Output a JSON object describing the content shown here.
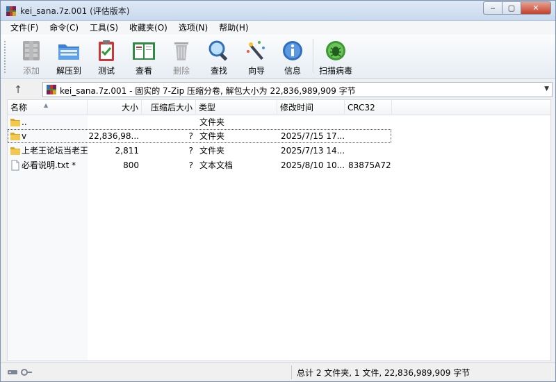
{
  "window": {
    "title": "kei_sana.7z.001 (评估版本)",
    "controls": {
      "minimize": "‒",
      "maximize": "▢",
      "close": "✕"
    }
  },
  "menu": [
    "文件(F)",
    "命令(C)",
    "工具(S)",
    "收藏夹(O)",
    "选项(N)",
    "帮助(H)"
  ],
  "toolbar": [
    {
      "label": "添加",
      "icon": "add-archive-icon",
      "disabled": true
    },
    {
      "label": "解压到",
      "icon": "extract-folder-icon",
      "disabled": false
    },
    {
      "label": "测试",
      "icon": "test-clipboard-icon",
      "disabled": false
    },
    {
      "label": "查看",
      "icon": "view-book-icon",
      "disabled": false
    },
    {
      "label": "删除",
      "icon": "trash-icon",
      "disabled": true
    },
    {
      "label": "查找",
      "icon": "magnifier-icon",
      "disabled": false
    },
    {
      "label": "向导",
      "icon": "wizard-wand-icon",
      "disabled": false
    },
    {
      "label": "信息",
      "icon": "info-icon",
      "disabled": false
    },
    {
      "label": "扫描病毒",
      "icon": "virus-bug-icon",
      "disabled": false
    }
  ],
  "address": {
    "up": "↑",
    "text": "kei_sana.7z.001 - 固实的 7-Zip 压缩分卷, 解包大小为 22,836,989,909 字节",
    "dropdown": "▼"
  },
  "columns": {
    "name": "名称",
    "size": "大小",
    "packed": "压缩后大小",
    "type": "类型",
    "modified": "修改时间",
    "crc": "CRC32"
  },
  "rows": [
    {
      "name": "..",
      "size": "",
      "packed": "",
      "type": "文件夹",
      "modified": "",
      "crc": "",
      "icon": "folder-icon"
    },
    {
      "name": "v",
      "size": "22,836,98...",
      "packed": "?",
      "type": "文件夹",
      "modified": "2025/7/15 17...",
      "crc": "",
      "icon": "folder-icon"
    },
    {
      "name": "上老王论坛当老王",
      "size": "2,811",
      "packed": "?",
      "type": "文件夹",
      "modified": "2025/7/13 14...",
      "crc": "",
      "icon": "folder-icon"
    },
    {
      "name": "必看说明.txt *",
      "size": "800",
      "packed": "?",
      "type": "文本文档",
      "modified": "2025/8/10 10...",
      "crc": "83875A72",
      "icon": "text-file-icon"
    }
  ],
  "status": {
    "summary": "总计 2 文件夹, 1 文件, 22,836,989,909 字节"
  }
}
